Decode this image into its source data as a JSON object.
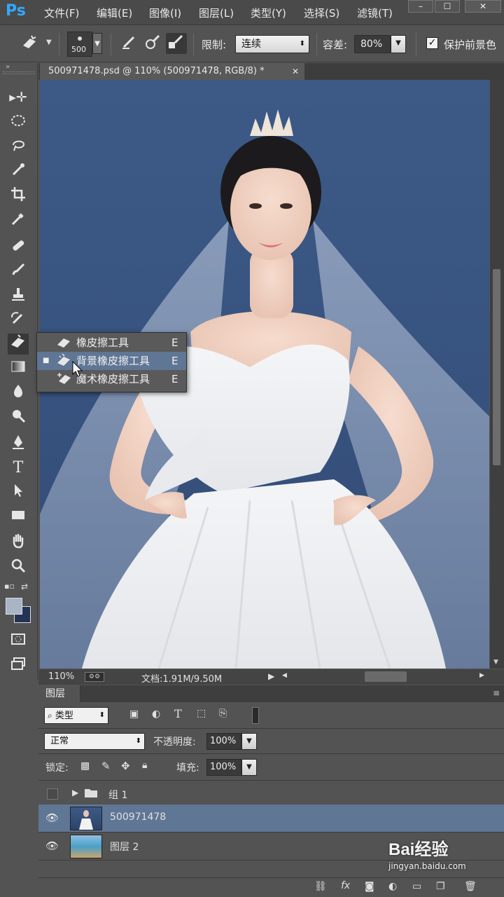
{
  "app": {
    "logo": "Ps",
    "menus": [
      "文件(F)",
      "编辑(E)",
      "图像(I)",
      "图层(L)",
      "类型(Y)",
      "选择(S)",
      "滤镜(T)"
    ],
    "window_controls": [
      "–",
      "☐",
      "✕"
    ]
  },
  "options": {
    "brush_size": "500",
    "limit_label": "限制:",
    "limit_value": "连续",
    "tolerance_label": "容差:",
    "tolerance_value": "80%",
    "protect_label": "保护前景色",
    "protect_checked": true
  },
  "document": {
    "tab_title": "500971478.psd @ 110% (500971478, RGB/8) *",
    "zoom": "110%",
    "doc_info": "文档:1.91M/9.50M"
  },
  "flyout": {
    "items": [
      {
        "label": "橡皮擦工具",
        "shortcut": "E"
      },
      {
        "label": "背景橡皮擦工具",
        "shortcut": "E"
      },
      {
        "label": "魔术橡皮擦工具",
        "shortcut": "E"
      }
    ],
    "selected_index": 1
  },
  "layers_panel": {
    "tab_label": "图层",
    "filter_label": "类型",
    "blend_mode": "正常",
    "opacity_label": "不透明度:",
    "opacity_value": "100%",
    "lock_label": "锁定:",
    "fill_label": "填充:",
    "fill_value": "100%",
    "layers": [
      {
        "name": "组 1",
        "type": "group",
        "visible": false
      },
      {
        "name": "500971478",
        "type": "pixel",
        "visible": true,
        "selected": true
      },
      {
        "name": "图层 2",
        "type": "pixel",
        "visible": true
      }
    ]
  },
  "watermark": {
    "brand": "Bai经验",
    "url": "jingyan.baidu.com"
  },
  "colors": {
    "accent": "#31a8ff",
    "panel_bg": "#535353",
    "selection": "#5f7695",
    "backdrop_blue": "#3d5a87"
  }
}
